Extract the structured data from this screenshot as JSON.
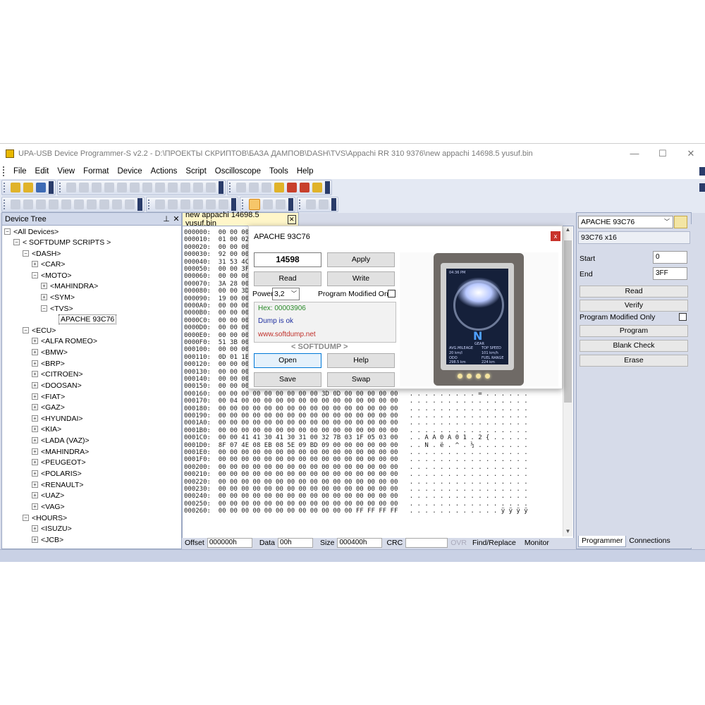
{
  "window": {
    "title": "UPA-USB Device Programmer-S v2.2 - D:\\ПРОЕКТЫ СКРИПТОВ\\БАЗА ДАМПОВ\\DASH\\TVS\\Appachi RR 310 9376\\new appachi 14698.5 yusuf.bin",
    "minimize": "—",
    "maximize": "☐",
    "close": "✕"
  },
  "menu": [
    "File",
    "Edit",
    "View",
    "Format",
    "Device",
    "Actions",
    "Script",
    "Oscilloscope",
    "Tools",
    "Help"
  ],
  "device_tree": {
    "title": "Device Tree",
    "pin": "⊥",
    "close": "✕",
    "nodes": [
      {
        "label": "<All Devices>",
        "toggle": "−"
      },
      {
        "label": "< SOFTDUMP SCRIPTS >",
        "toggle": "−"
      },
      {
        "label": "<DASH>",
        "toggle": "−"
      },
      {
        "label": "<CAR>",
        "toggle": "+"
      },
      {
        "label": "<MOTO>",
        "toggle": "−"
      },
      {
        "label": "<MAHINDRA>",
        "toggle": "+"
      },
      {
        "label": "<SYM>",
        "toggle": "+"
      },
      {
        "label": "<TVS>",
        "toggle": "−"
      },
      {
        "label": "APACHE 93C76",
        "toggle": ""
      },
      {
        "label": "<ECU>",
        "toggle": "−"
      },
      {
        "label": "<ALFA ROMEO>",
        "toggle": "+"
      },
      {
        "label": "<BMW>",
        "toggle": "+"
      },
      {
        "label": "<BRP>",
        "toggle": "+"
      },
      {
        "label": "<CITROEN>",
        "toggle": "+"
      },
      {
        "label": "<DOOSAN>",
        "toggle": "+"
      },
      {
        "label": "<FIAT>",
        "toggle": "+"
      },
      {
        "label": "<GAZ>",
        "toggle": "+"
      },
      {
        "label": "<HYUNDAI>",
        "toggle": "+"
      },
      {
        "label": "<KIA>",
        "toggle": "+"
      },
      {
        "label": "<LADA (VAZ)>",
        "toggle": "+"
      },
      {
        "label": "<MAHINDRA>",
        "toggle": "+"
      },
      {
        "label": "<PEUGEOT>",
        "toggle": "+"
      },
      {
        "label": "<POLARIS>",
        "toggle": "+"
      },
      {
        "label": "<RENAULT>",
        "toggle": "+"
      },
      {
        "label": "<UAZ>",
        "toggle": "+"
      },
      {
        "label": "<VAG>",
        "toggle": "+"
      },
      {
        "label": "<HOURS>",
        "toggle": "−"
      },
      {
        "label": "<ISUZU>",
        "toggle": "+"
      },
      {
        "label": "<JCB>",
        "toggle": "+"
      }
    ]
  },
  "document_tab": {
    "label": "new appachi 14698.5 yusuf.bin",
    "close": "✕"
  },
  "hex_rows": [
    "000000:  00 00 00 0",
    "000010:  01 00 02 0",
    "000020:  00 00 00 0",
    "000030:  92 00 00 0",
    "000040:  31 53 4C 5",
    "000050:  00 00 3F 0",
    "000060:  00 00 00 0",
    "000070:  3A 28 00 0",
    "000080:  00 00 3D 0",
    "000090:  19 00 00 0",
    "0000A0:  00 00 00 0",
    "0000B0:  00 00 00 0",
    "0000C0:  00 00 00 0",
    "0000D0:  00 00 00 0",
    "0000E0:  00 00 00 0",
    "0000F0:  51 3B 00 0",
    "000100:  00 00 00 0",
    "000110:  0D 01 1E 3",
    "000120:  00 00 00 0",
    "000130:  00 00 00 0",
    "000140:  00 00 00 00 00 00 00 00 00 00 00 00 00 00 00 00   . . . . . . . . . . . . . . . .",
    "000150:  00 00 00 00 00 00 00 00 00 00 00 00 00 00 00 00   . . . . . . . . . . . . . . . .",
    "000160:  00 00 00 00 00 00 00 00 00 3D 0D 00 00 00 00 00   . . . . . . . . . = . . . . . .",
    "000170:  00 04 00 00 00 00 00 00 00 00 00 00 00 00 00 00   . . . . . . . . . . . . . . . .",
    "000180:  00 00 00 00 00 00 00 00 00 00 00 00 00 00 00 00   . . . . . . . . . . . . . . . .",
    "000190:  00 00 00 00 00 00 00 00 00 00 00 00 00 00 00 00   . . . . . . . . . . . . . . . .",
    "0001A0:  00 00 00 00 00 00 00 00 00 00 00 00 00 00 00 00   . . . . . . . . . . . . . . . .",
    "0001B0:  00 00 00 00 00 00 00 00 00 00 00 00 00 00 00 00   . . . . . . . . . . . . . . . .",
    "0001C0:  00 00 41 41 30 41 30 31 00 32 7B 03 1F 05 03 00   . . A A 0 A 0 1 . 2 { . . . . .",
    "0001D0:  8F 07 4E 08 EB 08 5E 09 BD 09 00 00 00 00 00 00   . . N . ë . ^ . ½ . . . . . . .",
    "0001E0:  00 00 00 00 00 00 00 00 00 00 00 00 00 00 00 00   . . . . . . . . . . . . . . . .",
    "0001F0:  00 00 00 00 00 00 00 00 00 00 00 00 00 00 00 00   . . . . . . . . . . . . . . . .",
    "000200:  00 00 00 00 00 00 00 00 00 00 00 00 00 00 00 00   . . . . . . . . . . . . . . . .",
    "000210:  00 00 00 00 00 00 00 00 00 00 00 00 00 00 00 00   . . . . . . . . . . . . . . . .",
    "000220:  00 00 00 00 00 00 00 00 00 00 00 00 00 00 00 00   . . . . . . . . . . . . . . . .",
    "000230:  00 00 00 00 00 00 00 00 00 00 00 00 00 00 00 00   . . . . . . . . . . . . . . . .",
    "000240:  00 00 00 00 00 00 00 00 00 00 00 00 00 00 00 00   . . . . . . . . . . . . . . . .",
    "000250:  00 00 00 00 00 00 00 00 00 00 00 00 00 00 00 00   . . . . . . . . . . . . . . . .",
    "000260:  00 00 00 00 00 00 00 00 00 00 00 00 FF FF FF FF   . . . . . . . . . . . . ÿ ÿ ÿ ÿ"
  ],
  "status": {
    "offset_label": "Offset",
    "offset_value": "000000h",
    "data_label": "Data",
    "data_value": "00h",
    "size_label": "Size",
    "size_value": "000400h",
    "crc_label": "CRC",
    "crc_value": "",
    "ovr": "OVR",
    "find_replace": "Find/Replace",
    "monitor": "Monitor"
  },
  "dialog": {
    "title": "APACHE 93C76",
    "close": "x",
    "counter_value": "14598",
    "apply": "Apply",
    "read": "Read",
    "write": "Write",
    "power_label": "Power",
    "power_value": "3,2",
    "program_modified_label": "Program Modified Only",
    "info_hex": "Hex: 00003906",
    "info_status": "Dump is ok",
    "info_url": "www.softdump.net",
    "brand": "< SOFTDUMP >",
    "open": "Open",
    "help": "Help",
    "save": "Save",
    "swap": "Swap",
    "photo": {
      "time": "04:36 PM",
      "gear": "N",
      "gear_caption": "GEAR",
      "avg_mileage": "AVG.MILEAGE",
      "avg_mileage_val": "20 km/l",
      "top_speed": "TOP SPEED",
      "top_speed_val": "101 km/h",
      "odo": "ODO",
      "odo_val": "298.5 km",
      "fuel_range": "FUEL RANGE",
      "fuel_range_val": "224 km"
    }
  },
  "right_panel": {
    "device": "APACHE 93C76",
    "desc": "93C76 x16",
    "start_label": "Start",
    "start_value": "0",
    "end_label": "End",
    "end_value": "3FF",
    "read": "Read",
    "verify": "Verify",
    "program_modified_label": "Program Modified Only",
    "program": "Program",
    "blank_check": "Blank Check",
    "erase": "Erase",
    "tab_programmer": "Programmer",
    "tab_connections": "Connections"
  }
}
